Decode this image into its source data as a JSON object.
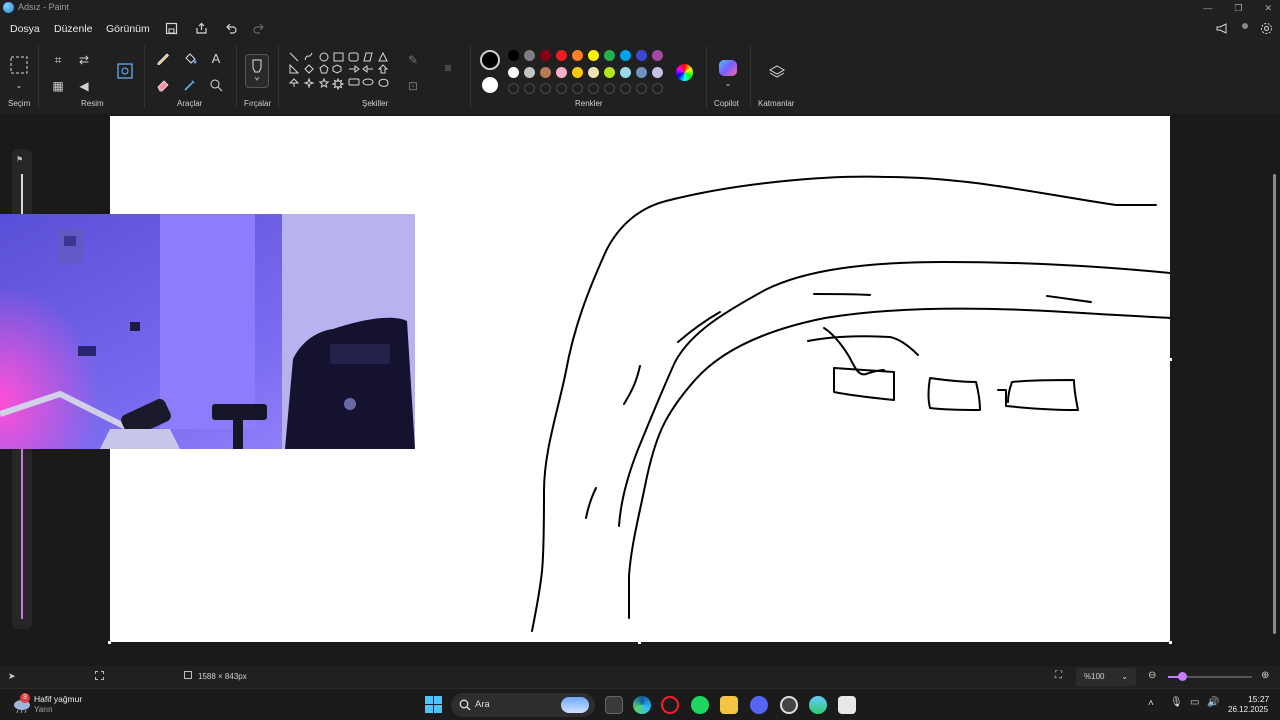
{
  "window": {
    "title": "Adsız - Paint",
    "controls": [
      "—",
      "❐",
      "✕"
    ]
  },
  "menu": {
    "items": [
      "Dosya",
      "Düzenle",
      "Görünüm"
    ]
  },
  "ribbon": {
    "groups": [
      "Seçim",
      "Resim",
      "Araçlar",
      "Fırçalar",
      "Şekiller",
      "Renkler",
      "Copilot",
      "Katmanlar"
    ]
  },
  "colors": {
    "current": "#000000",
    "secondary": "#ffffff",
    "palette_row1": [
      "#000000",
      "#7f7f7f",
      "#880015",
      "#ed1c24",
      "#ff7f27",
      "#fff200",
      "#22b14c",
      "#00a2e8",
      "#3f48cc",
      "#a349a4"
    ],
    "palette_row2": [
      "#ffffff",
      "#c3c3c3",
      "#b97a57",
      "#ffaec9",
      "#ffc90e",
      "#efe4b0",
      "#b5e61d",
      "#99d9ea",
      "#7092be",
      "#c8bfe7"
    ]
  },
  "status": {
    "canvas_size": "1588 × 843px",
    "zoom": "%100"
  },
  "taskbar": {
    "weather_title": "Hafif yağmur",
    "weather_sub": "Yarın",
    "weather_badge": "3",
    "search_placeholder": "Ara",
    "time": "15:27",
    "date": "26.12.2025"
  }
}
